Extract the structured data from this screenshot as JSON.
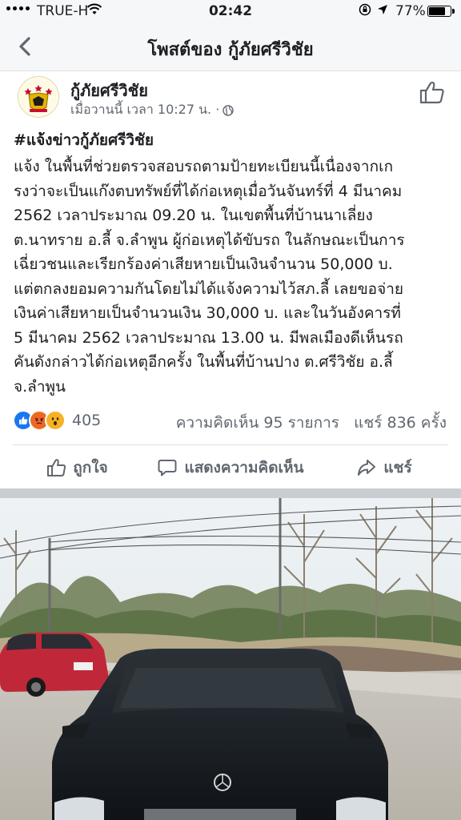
{
  "status_bar": {
    "carrier": "TRUE-H",
    "time": "02:42",
    "battery": "77%",
    "battery_level": 0.77
  },
  "nav": {
    "title": "โพสต์ของ กู้ภัยศรีวิชัย"
  },
  "post": {
    "author": "กู้ภัยศรีวิชัย",
    "timestamp": "เมื่อวานนี้ เวลา 10:27 น. ·",
    "hashtag": "#แจ้งข่าวกู้ภัยศรีวิชัย",
    "body": "แจ้ง ในพื้นที่ช่วยตรวจสอบรถตามป้ายทะเบียนนี้เนื่องจากเก\nรงว่าจะเป็นแก๊งตบทรัพย์ที่ได้ก่อเหตุเมื่อวันจันทร์ที่ 4 มีนาคม\n2562 เวลาประมาณ 09.20 น. ในเขตพื้นที่บ้านนาเลี่ยง\nต.นาทราย อ.ลี้ จ.ลำพูน ผู้ก่อเหตุได้ขับรถ ในลักษณะเป็นการ\nเฉี่ยวชนและเรียกร้องค่าเสียหายเป็นเงินจำนวน 50,000 บ.\nแต่ตกลงยอมความกันโดยไม่ได้แจ้งความไว้สภ.ลี้ เลยขอจ่าย\nเงินค่าเสียหายเป็นจำนวนเงิน 30,000 บ. และในวันอังคารที่\n5 มีนาคม 2562 เวลาประมาณ 13.00 น. มีพลเมืองดีเห็นรถ\nคันดังกล่าวได้ก่อเหตุอีกครั้ง ในพื้นที่บ้านปาง ต.ศรีวิชัย อ.ลี้\nจ.ลำพูน",
    "reaction_count": "405",
    "comments": "ความคิดเห็น 95 รายการ",
    "shares": "แชร์ 836 ครั้ง"
  },
  "actions": {
    "like": "ถูกใจ",
    "comment": "แสดงความคิดเห็น",
    "share": "แชร์"
  },
  "icons": {
    "status": [
      "signal-dots-icon",
      "wifi-icon",
      "orientation-lock-icon",
      "location-arrow-icon",
      "battery-icon"
    ],
    "nav": [
      "back-chevron-icon"
    ],
    "post": [
      "page-avatar",
      "globe-icon",
      "like-thumb-icon"
    ],
    "reactions": [
      "like-reaction-icon",
      "angry-reaction-icon",
      "wow-reaction-icon"
    ],
    "actions": [
      "like-icon",
      "comment-icon",
      "share-icon"
    ]
  }
}
